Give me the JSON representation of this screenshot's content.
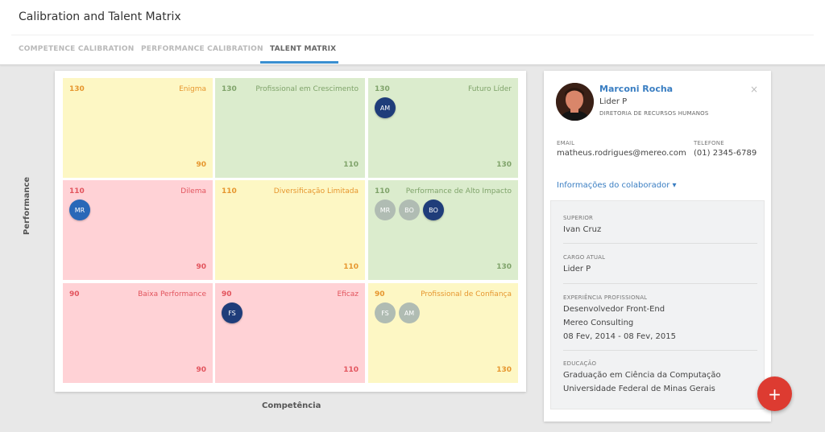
{
  "header": {
    "title": "Calibration and Talent Matrix"
  },
  "tabs": [
    "COMPETENCE CALIBRATION",
    "PERFORMANCE CALIBRATION",
    "TALENT MATRIX"
  ],
  "active_tab": "TALENT MATRIX",
  "matrix": {
    "y_axis_label": "Performance",
    "x_axis_label": "Competência",
    "cells": [
      {
        "color": "yellow",
        "top_value": "130",
        "name": "Enigma",
        "bottom_value": "90",
        "avatars": []
      },
      {
        "color": "green",
        "top_value": "130",
        "name": "Profissional em Crescimento",
        "bottom_value": "110",
        "avatars": []
      },
      {
        "color": "green",
        "top_value": "130",
        "name": "Futuro Líder",
        "bottom_value": "130",
        "avatars": [
          {
            "initials": "AM",
            "style": "dark"
          }
        ]
      },
      {
        "color": "red",
        "top_value": "110",
        "name": "Dilema",
        "bottom_value": "90",
        "avatars": [
          {
            "initials": "MR",
            "style": "blue"
          }
        ]
      },
      {
        "color": "yellow",
        "top_value": "110",
        "name": "Diversificação Limitada",
        "bottom_value": "110",
        "avatars": []
      },
      {
        "color": "green",
        "top_value": "110",
        "name": "Performance de Alto Impacto",
        "bottom_value": "130",
        "avatars": [
          {
            "initials": "MR",
            "style": "faded"
          },
          {
            "initials": "BO",
            "style": "faded"
          },
          {
            "initials": "BO",
            "style": "dark"
          }
        ]
      },
      {
        "color": "red",
        "top_value": "90",
        "name": "Baixa Performance",
        "bottom_value": "90",
        "avatars": []
      },
      {
        "color": "red",
        "top_value": "90",
        "name": "Eficaz",
        "bottom_value": "110",
        "avatars": [
          {
            "initials": "FS",
            "style": "dark"
          }
        ]
      },
      {
        "color": "yellow",
        "top_value": "90",
        "name": "Profissional de Confiança",
        "bottom_value": "130",
        "avatars": [
          {
            "initials": "FS",
            "style": "faded"
          },
          {
            "initials": "AM",
            "style": "faded"
          }
        ]
      }
    ]
  },
  "profile": {
    "name": "Marconi Rocha",
    "role": "Lider P",
    "department": "DIRETORIA DE RECURSOS HUMANOS",
    "close_icon": "×",
    "email_label": "EMAIL",
    "email": "matheus.rodrigues@mereo.com",
    "phone_label": "TELEFONE",
    "phone": "(01) 2345-6789",
    "info_toggle": "Informações do colaborador ▾",
    "superior_label": "SUPERIOR",
    "superior": "Ivan Cruz",
    "cargo_label": "CARGO ATUAL",
    "cargo": "Lider P",
    "experience_label": "EXPERIÊNCIA PROFISSIONAL",
    "experience_role": "Desenvolvedor Front-End",
    "experience_company": "Mereo Consulting",
    "experience_period": "08 Fev, 2014 - 08 Fev, 2015",
    "education_label": "EDUCAÇÃO",
    "education_course": "Graduação em Ciência da Computação",
    "education_school": "Universidade Federal de Minas Gerais"
  },
  "fab": {
    "label": "+"
  },
  "colors": {
    "accent": "#3a8fd0",
    "link": "#3a7ec2",
    "fab": "#dd3b31",
    "yellow": "#fdf7c4",
    "green": "#dbeccd",
    "red": "#ffd2d6"
  }
}
